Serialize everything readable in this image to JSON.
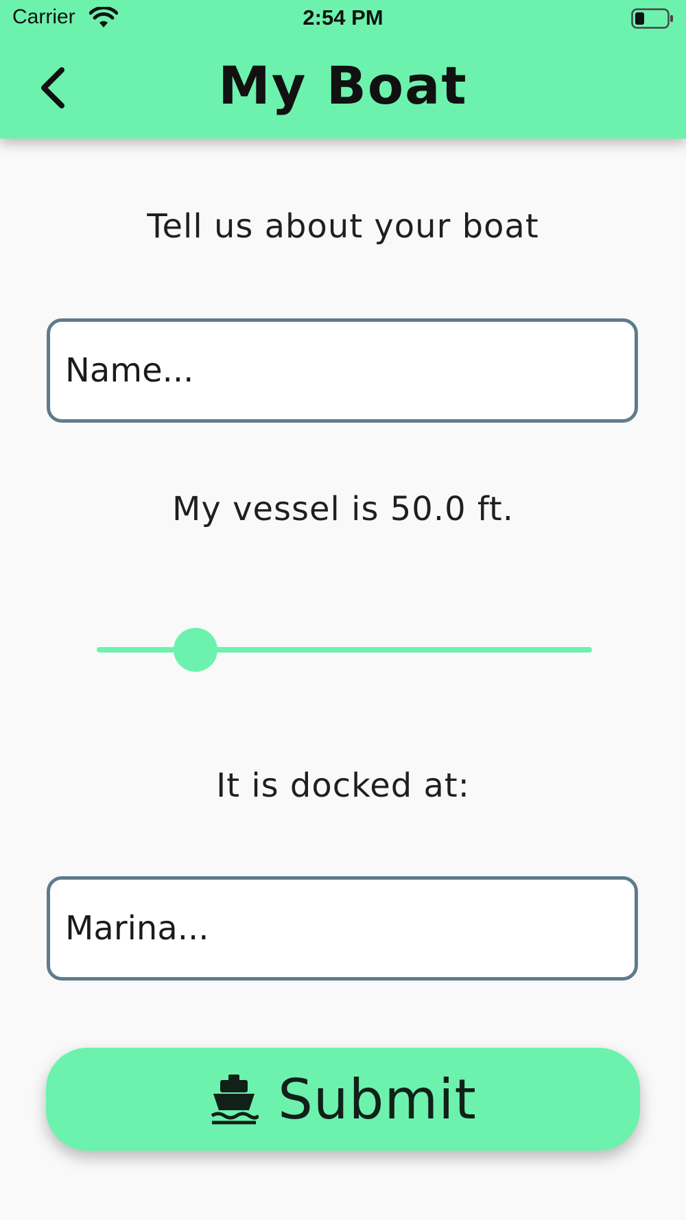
{
  "status_bar": {
    "carrier": "Carrier",
    "time": "2:54 PM",
    "wifi_icon": "wifi-icon",
    "battery_icon": "battery-icon"
  },
  "header": {
    "title": "My Boat",
    "back_icon": "chevron-left-icon"
  },
  "form": {
    "intro": "Tell us about your boat",
    "name_field": {
      "placeholder": "Name...",
      "value": ""
    },
    "length_label": "My vessel is 50.0 ft.",
    "length_slider": {
      "value": 50.0,
      "fraction": 0.2
    },
    "dock_label": "It is docked at:",
    "marina_field": {
      "placeholder": "Marina...",
      "value": ""
    },
    "submit": {
      "label": "Submit",
      "icon": "ship-icon"
    }
  },
  "colors": {
    "accent": "#6cf2ad",
    "field_border": "#5f7b8b",
    "background": "#f9f9f9"
  }
}
